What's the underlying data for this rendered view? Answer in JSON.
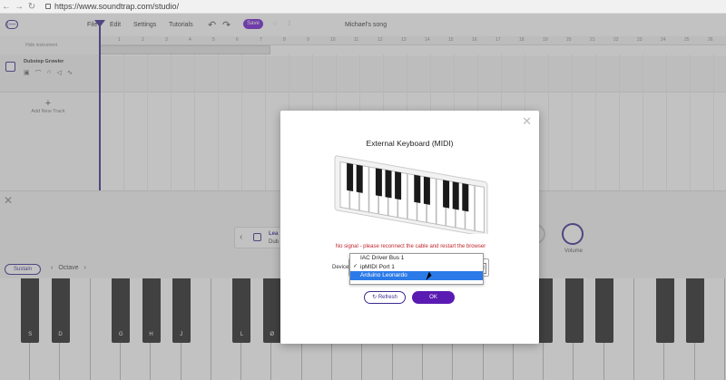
{
  "browser": {
    "url": "https://www.soundtrap.com/studio/"
  },
  "app": {
    "logo": "(—)",
    "menu": [
      "File",
      "Edit",
      "Settings",
      "Tutorials"
    ],
    "save_label": "Save",
    "song_title": "Michael's song",
    "accent_color": "#6f1bd0"
  },
  "tracks": {
    "hide_label": "Hide instrument",
    "items": [
      {
        "name": "Dubstep Growler"
      }
    ],
    "add_label": "Add New Track",
    "ruler": [
      "1",
      "2",
      "3",
      "4",
      "5",
      "6",
      "7",
      "8",
      "9",
      "10",
      "11",
      "12",
      "13",
      "14",
      "15",
      "16",
      "17",
      "18",
      "19",
      "20",
      "21",
      "22",
      "23",
      "24",
      "25",
      "26"
    ]
  },
  "dock": {
    "instrument_line1": "Lea",
    "instrument_line2": "Dub",
    "volume_label": "Volume",
    "sustain_label": "Sustain",
    "octave_label": "Octave",
    "key_labels": [
      "S",
      "D",
      "G",
      "H",
      "J",
      "L",
      "Ø"
    ]
  },
  "modal": {
    "title": "External Keyboard (MIDI)",
    "error": "No signal - please reconnect the cable and restart the browser",
    "device_label": "Device",
    "options": [
      {
        "label": "IAC Driver Bus 1",
        "checked": false,
        "highlighted": false
      },
      {
        "label": "ipMIDI Port 1",
        "checked": true,
        "highlighted": false
      },
      {
        "label": "Arduino Leonardo",
        "checked": false,
        "highlighted": true
      }
    ],
    "refresh_label": "Refresh",
    "ok_label": "OK",
    "error_color": "#c0262e"
  }
}
